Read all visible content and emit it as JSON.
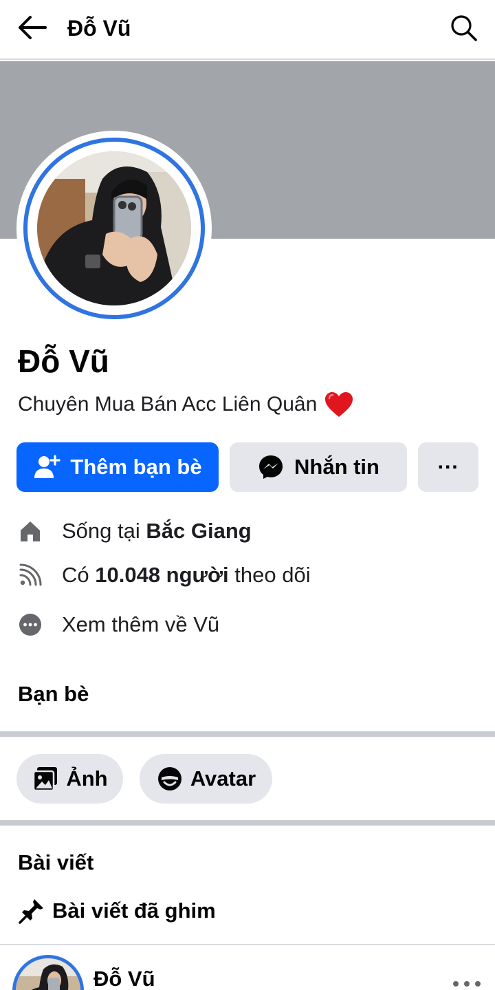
{
  "header": {
    "title": "Đỗ Vũ",
    "back_icon": "arrow-left-icon",
    "search_icon": "search-icon"
  },
  "profile": {
    "name": "Đỗ Vũ",
    "bio": "Chuyên Mua Bán Acc Liên Quân",
    "bio_emoji_icon": "red-heart-icon"
  },
  "actions": {
    "add_friend": "Thêm bạn bè",
    "message": "Nhắn tin",
    "more": "···"
  },
  "info": {
    "lives_prefix": "Sống tại ",
    "lives_place": "Bắc Giang",
    "followers_prefix": "Có ",
    "followers_bold": "10.048 người",
    "followers_suffix": " theo dõi",
    "see_more": "Xem thêm về Vũ"
  },
  "friends": {
    "title": "Bạn bè"
  },
  "chips": {
    "photos": "Ảnh",
    "avatar": "Avatar"
  },
  "posts": {
    "title": "Bài viết",
    "pinned_label": "Bài viết đã ghim",
    "first_post_author": "Đỗ Vũ"
  },
  "colors": {
    "primary": "#0866ff",
    "ring": "#2f74e0",
    "cover": "#a2a6ab",
    "button_grey": "#e4e6eb",
    "heart": "#e0161f"
  }
}
